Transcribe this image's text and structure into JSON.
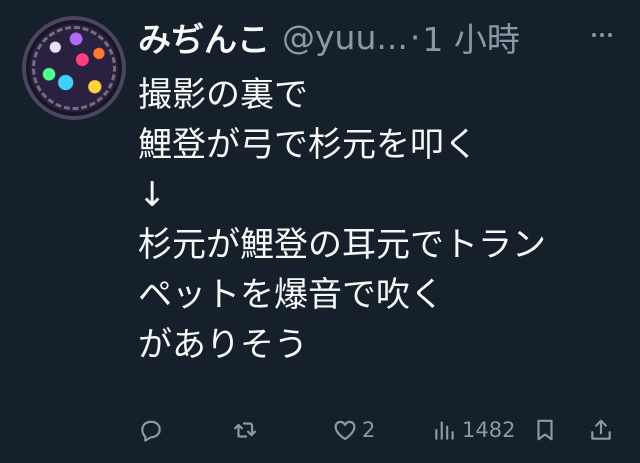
{
  "tweet": {
    "author": {
      "display_name": "みぢんこ",
      "handle": "@yuu...",
      "separator": "·",
      "timestamp": "1 小時"
    },
    "body_lines": [
      "撮影の裏で",
      "鯉登が弓で杉元を叩く",
      "↓",
      "杉元が鯉登の耳元でトラン",
      "ペットを爆音で吹く",
      "がありそう"
    ],
    "actions": {
      "reply_count": "",
      "retweet_count": "",
      "like_count": "2",
      "view_count": "1482"
    }
  },
  "icons": {
    "reply": "reply-icon",
    "retweet": "retweet-icon",
    "like": "heart-icon",
    "views": "views-chart-icon",
    "bookmark": "bookmark-icon",
    "share": "share-icon",
    "more": "more-icon"
  },
  "colors": {
    "background": "#15202b",
    "primary_text": "#f7f9f9",
    "secondary_text": "#8b98a5"
  }
}
